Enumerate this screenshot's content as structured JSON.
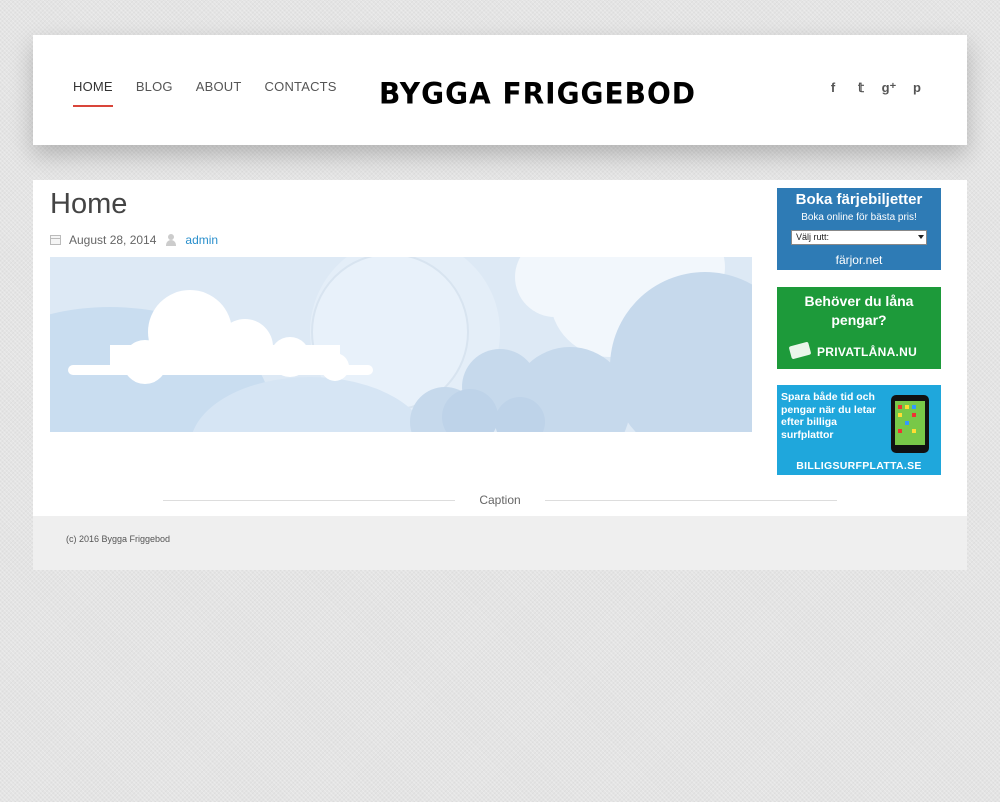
{
  "nav": {
    "items": [
      {
        "label": "HOME",
        "active": true
      },
      {
        "label": "BLOG",
        "active": false
      },
      {
        "label": "ABOUT",
        "active": false
      },
      {
        "label": "CONTACTS",
        "active": false
      }
    ],
    "active_color": "#d9453a"
  },
  "site": {
    "logo": "BYGGA FRIGGEBOD"
  },
  "social": {
    "facebook": "f",
    "twitter": "𝕥",
    "googleplus": "g⁺",
    "pinterest": "p",
    "icons": [
      "facebook-icon",
      "twitter-icon",
      "google-plus-icon",
      "pinterest-icon"
    ]
  },
  "post": {
    "title": "Home",
    "date": "August 28, 2014",
    "author": "admin",
    "caption": "Caption"
  },
  "ads": {
    "ferry": {
      "title": "Boka färjebiljetter",
      "subtitle": "Boka online för bästa pris!",
      "select_value": "Välj rutt:",
      "brand": "färjor.net",
      "color": "#2e7bb5"
    },
    "loan": {
      "title": "Behöver du låna pengar?",
      "brand": "PRIVATLÅNA.NU",
      "color": "#1d9a3a"
    },
    "tablet": {
      "title": "Spara både tid och pengar när du letar efter billiga surfplattor",
      "brand": "BILLIGSURFPLATTA.SE",
      "color": "#1fa7dc"
    }
  },
  "footer": {
    "text": "(c) 2016 Bygga Friggebod"
  }
}
